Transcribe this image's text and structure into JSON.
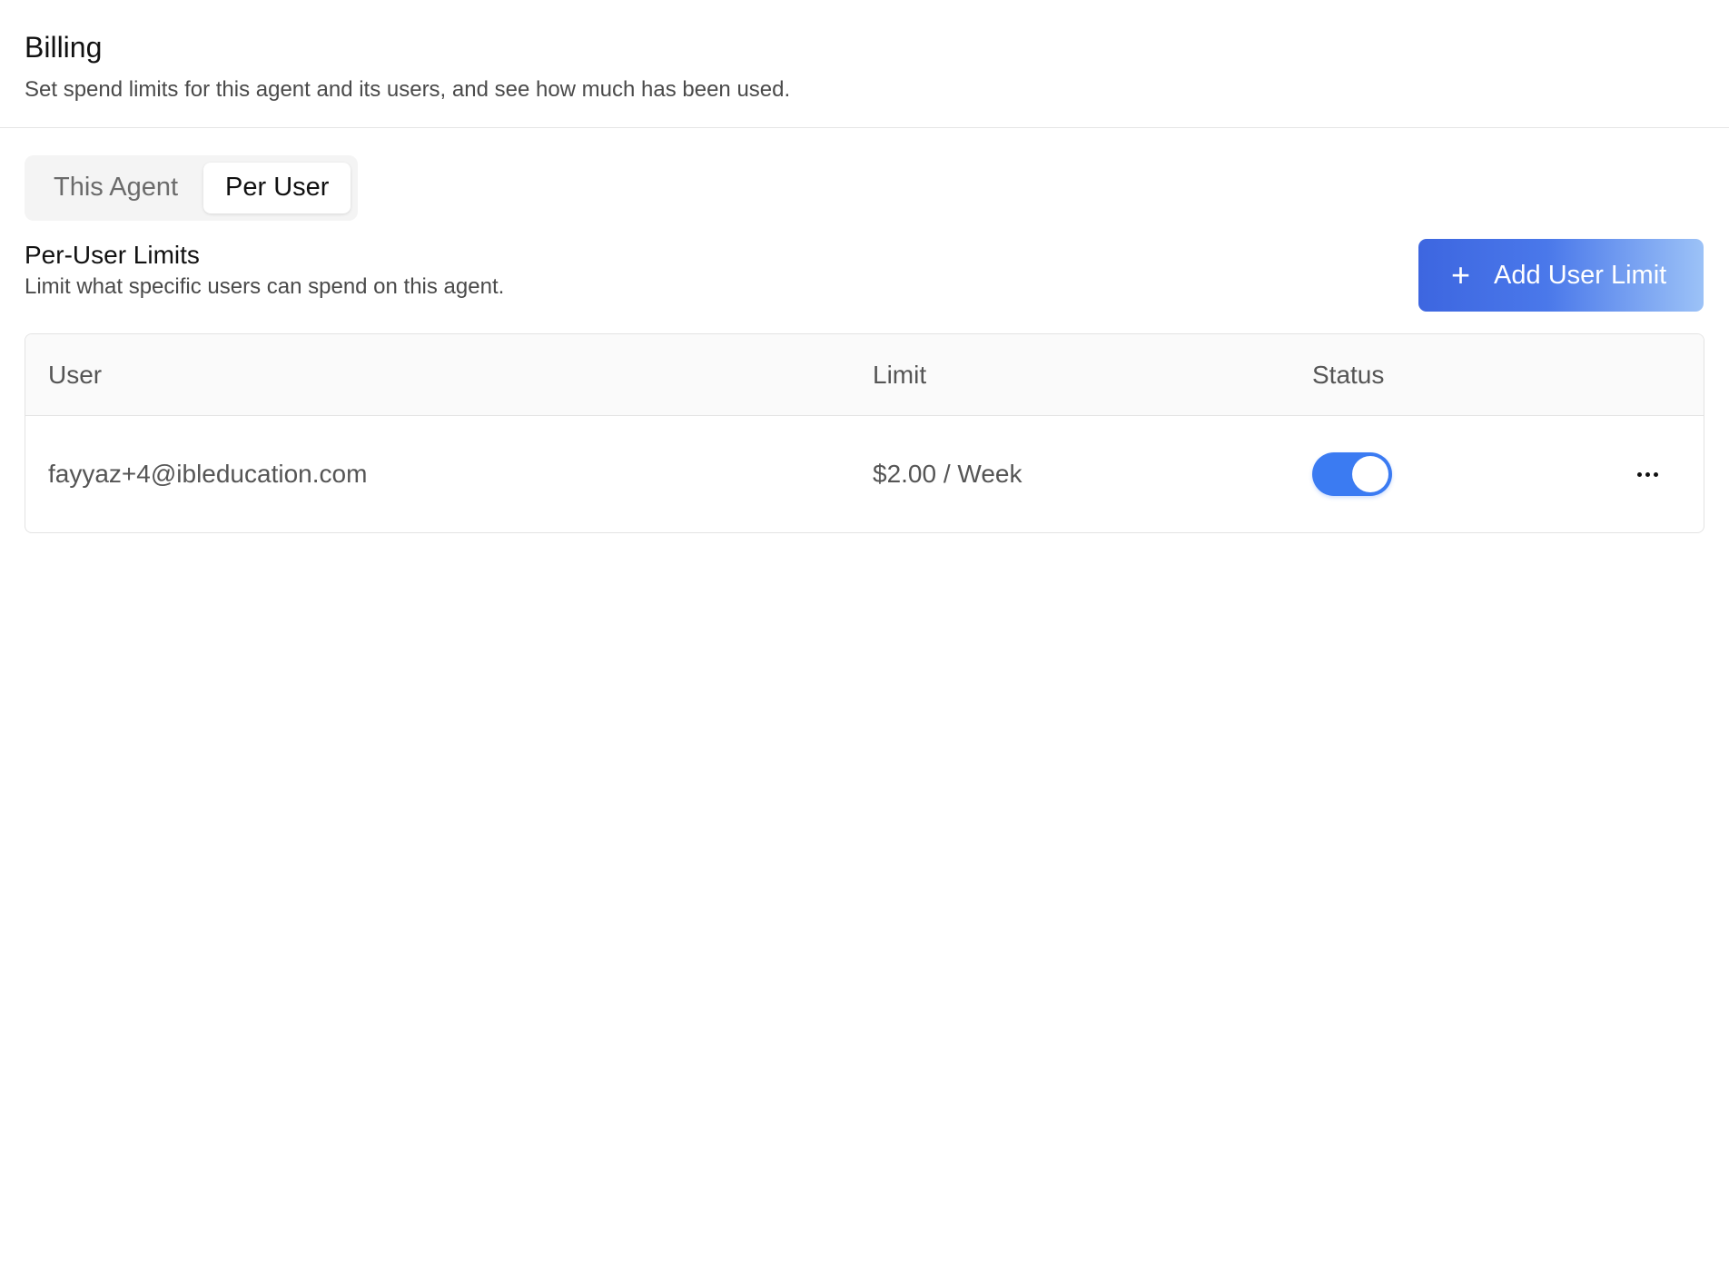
{
  "header": {
    "title": "Billing",
    "subtitle": "Set spend limits for this agent and its users, and see how much has been used."
  },
  "tabs": [
    {
      "label": "This Agent",
      "active": false
    },
    {
      "label": "Per User",
      "active": true
    }
  ],
  "section": {
    "title": "Per-User Limits",
    "subtitle": "Limit what specific users can spend on this agent.",
    "add_button_label": "Add User Limit",
    "add_button_icon": "plus-icon"
  },
  "table": {
    "columns": [
      "User",
      "Limit",
      "Status",
      ""
    ],
    "rows": [
      {
        "user": "fayyaz+4@ibleducation.com",
        "limit": "$2.00 / Week",
        "status_enabled": true,
        "actions_icon": "more-horizontal-icon"
      }
    ]
  },
  "colors": {
    "accent": "#3b7bf2",
    "button_gradient_start": "#3d66e0",
    "button_gradient_end": "#9cc2f7"
  }
}
